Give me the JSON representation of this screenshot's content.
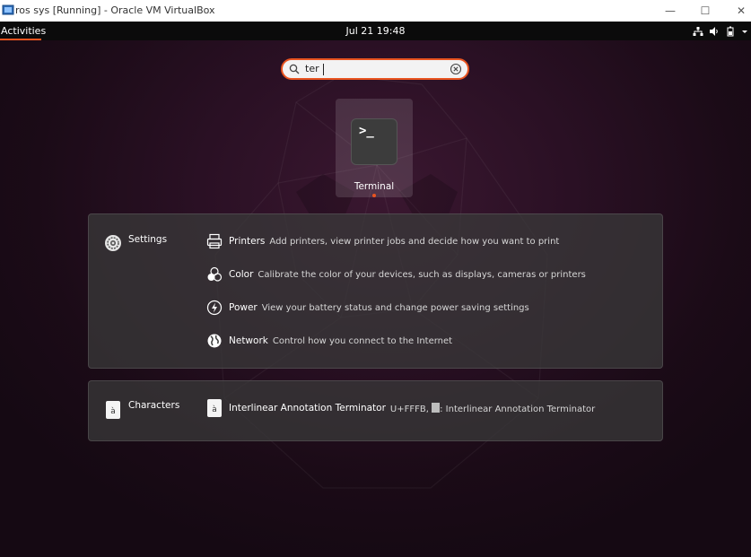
{
  "window": {
    "title": "ros sys [Running] - Oracle VM VirtualBox",
    "controls": [
      "—",
      "☐",
      "✕"
    ]
  },
  "topbar": {
    "activities": "Activities",
    "clock": "Jul 21  19:48",
    "tray_icons": [
      "network-wired-icon",
      "volume-icon",
      "battery-icon",
      "dropdown-arrow-icon"
    ]
  },
  "search": {
    "value": "ter"
  },
  "app_result": {
    "label": "Terminal",
    "prompt_glyph": ">_"
  },
  "providers": [
    {
      "name": "Settings",
      "icon": "settings-gear-icon",
      "results": [
        {
          "title": "Printers",
          "description": "Add printers, view printer jobs and decide how you want to print",
          "icon": "printer-icon"
        },
        {
          "title": "Color",
          "description": "Calibrate the color of your devices, such as displays, cameras or printers",
          "icon": "color-icon"
        },
        {
          "title": "Power",
          "description": "View your battery status and change power saving settings",
          "icon": "power-icon"
        },
        {
          "title": "Network",
          "description": "Control how you connect to the Internet",
          "icon": "globe-icon"
        }
      ]
    },
    {
      "name": "Characters",
      "icon": "characters-app-icon",
      "icon_glyph": "à",
      "results": [
        {
          "title": "Interlinear Annotation Terminator",
          "description_prefix": "U+FFFB,",
          "description_suffix": ": Interlinear Annotation Terminator",
          "icon": "character-icon",
          "glyph": "à"
        }
      ]
    }
  ],
  "colors": {
    "accent": "#e95420",
    "topbar": "#0b0b0b",
    "panel": "#3a3a3a"
  }
}
